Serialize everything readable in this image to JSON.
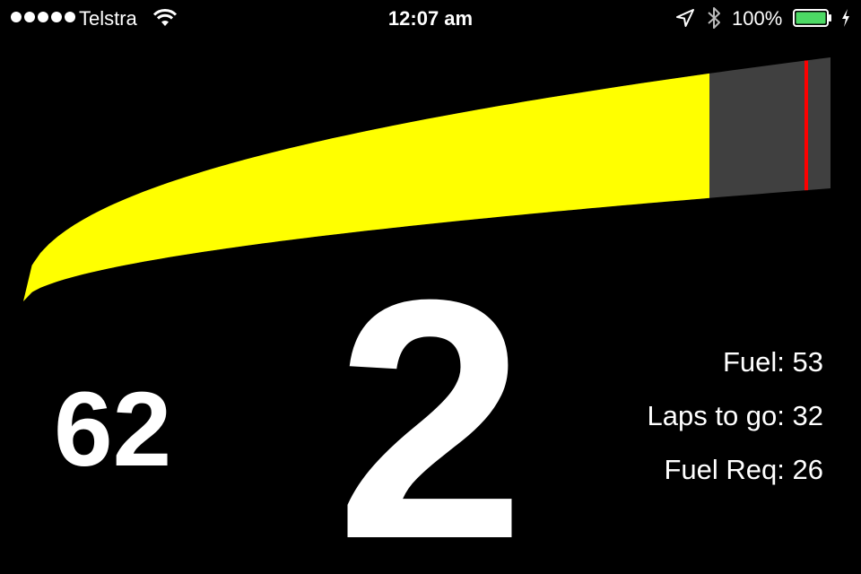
{
  "status_bar": {
    "carrier": "Telstra",
    "time": "12:07 am",
    "battery_percent": "100%",
    "signal_dots": 5,
    "icons": [
      "signal-dots-icon",
      "wifi-icon",
      "location-arrow-icon",
      "bluetooth-icon",
      "battery-icon",
      "charging-bolt-icon"
    ]
  },
  "dashboard": {
    "speed": "62",
    "gear": "2",
    "fuel_label": "Fuel: 53",
    "laps_label": "Laps to go: 32",
    "fuel_req_label": "Fuel Req: 26",
    "rpm_fraction": 0.85,
    "shift_point_fraction": 0.97
  },
  "colors": {
    "background": "#000000",
    "rpm_fill": "#ffff00",
    "rpm_track": "#404040",
    "shift_line": "#ff0000",
    "text": "#ffffff",
    "battery_fill": "#4cd964"
  }
}
